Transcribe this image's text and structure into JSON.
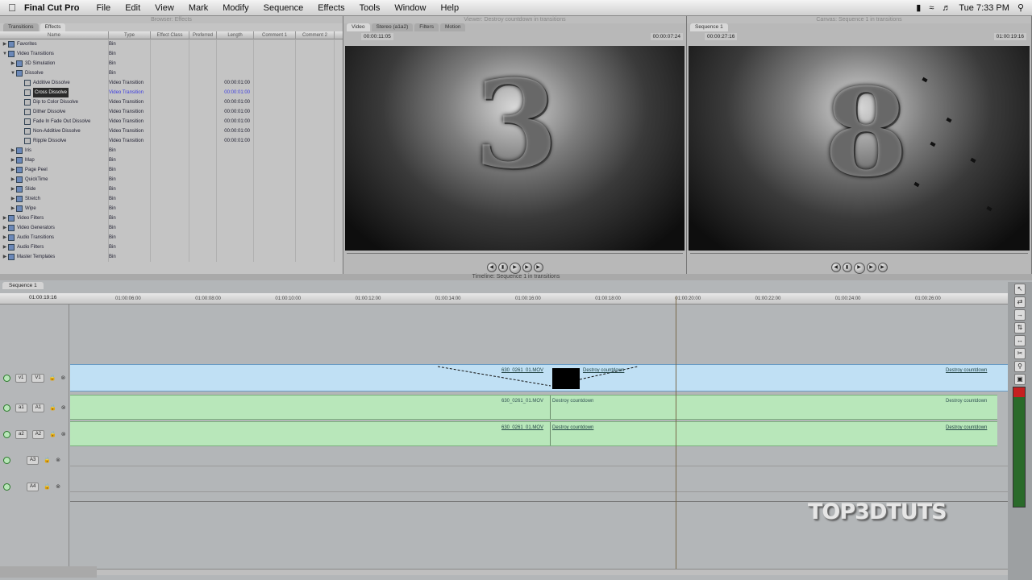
{
  "menubar": {
    "app_name": "Final Cut Pro",
    "items": [
      "File",
      "Edit",
      "View",
      "Mark",
      "Modify",
      "Sequence",
      "Effects",
      "Tools",
      "Window",
      "Help"
    ],
    "clock": "Tue 7:33 PM"
  },
  "browser": {
    "title": "Browser: Effects",
    "tabs": [
      "Transitions",
      "Effects"
    ],
    "columns": [
      "Name",
      "Type",
      "Effect Class",
      "Preferred",
      "Length",
      "Comment 1",
      "Comment 2"
    ],
    "rows": [
      {
        "name": "Favorites",
        "type": "Bin",
        "length": ""
      },
      {
        "name": "Video Transitions",
        "type": "Bin",
        "length": ""
      },
      {
        "name": "3D Simulation",
        "type": "Bin",
        "length": ""
      },
      {
        "name": "Dissolve",
        "type": "Bin",
        "length": ""
      },
      {
        "name": "Additive Dissolve",
        "type": "Video Transition",
        "length": "00:00:01:00"
      },
      {
        "name": "Cross Dissolve",
        "type": "Video Transition",
        "length": "00:00:01:00"
      },
      {
        "name": "Dip to Color Dissolve",
        "type": "Video Transition",
        "length": "00:00:01:00"
      },
      {
        "name": "Dither Dissolve",
        "type": "Video Transition",
        "length": "00:00:01:00"
      },
      {
        "name": "Fade In Fade Out Dissolve",
        "type": "Video Transition",
        "length": "00:00:01:00"
      },
      {
        "name": "Non-Additive Dissolve",
        "type": "Video Transition",
        "length": "00:00:01:00"
      },
      {
        "name": "Ripple Dissolve",
        "type": "Video Transition",
        "length": "00:00:01:00"
      },
      {
        "name": "Iris",
        "type": "Bin",
        "length": ""
      },
      {
        "name": "Map",
        "type": "Bin",
        "length": ""
      },
      {
        "name": "Page Peel",
        "type": "Bin",
        "length": ""
      },
      {
        "name": "QuickTime",
        "type": "Bin",
        "length": ""
      },
      {
        "name": "Slide",
        "type": "Bin",
        "length": ""
      },
      {
        "name": "Stretch",
        "type": "Bin",
        "length": ""
      },
      {
        "name": "Wipe",
        "type": "Bin",
        "length": ""
      },
      {
        "name": "Video Filters",
        "type": "Bin",
        "length": ""
      },
      {
        "name": "Video Generators",
        "type": "Bin",
        "length": ""
      },
      {
        "name": "Audio Transitions",
        "type": "Bin",
        "length": ""
      },
      {
        "name": "Audio Filters",
        "type": "Bin",
        "length": ""
      },
      {
        "name": "Master Templates",
        "type": "Bin",
        "length": ""
      }
    ]
  },
  "viewer": {
    "title": "Viewer: Destroy countdown in transitions",
    "tabs": [
      "Video",
      "Stereo (a1a2)",
      "Filters",
      "Motion"
    ],
    "timecode_duration": "00:00:11:05",
    "timecode_current": "00:00:07:24",
    "numeral": "3"
  },
  "canvas": {
    "title": "Canvas: Sequence 1 in transitions",
    "tab": "Sequence 1",
    "timecode_duration": "00:00:27:16",
    "timecode_current": "01:00:19:16",
    "numeral": "8"
  },
  "timeline": {
    "title": "Timeline: Sequence 1 in transitions",
    "tab": "Sequence 1",
    "current_timecode": "01:00:19:16",
    "ruler_ticks": [
      "01:00:06:00",
      "01:00:08:00",
      "01:00:10:00",
      "01:00:12:00",
      "01:00:14:00",
      "01:00:16:00",
      "01:00:18:00",
      "01:00:20:00",
      "01:00:22:00",
      "01:00:24:00",
      "01:00:26:00"
    ],
    "track_headers": [
      {
        "src": "v1",
        "dst": "V1"
      },
      {
        "src": "a1",
        "dst": "A1"
      },
      {
        "src": "a2",
        "dst": "A2"
      },
      {
        "src": "",
        "dst": "A3"
      },
      {
        "src": "",
        "dst": "A4"
      }
    ],
    "clips": {
      "v1_clip_a": "630_0261_01.MOV",
      "v1_clip_b": "Destroy countdown",
      "v1_clip_c": "Destroy countdown",
      "a1_clip_a": "630_0261_01.MOV",
      "a1_clip_b": "Destroy countdown",
      "a1_clip_c": "Destroy countdown",
      "a2_clip_a": "630_0261_01.MOV",
      "a2_clip_b": "Destroy countdown",
      "a2_clip_c": "Destroy countdown"
    }
  },
  "watermark": "TOP3DTUTS"
}
